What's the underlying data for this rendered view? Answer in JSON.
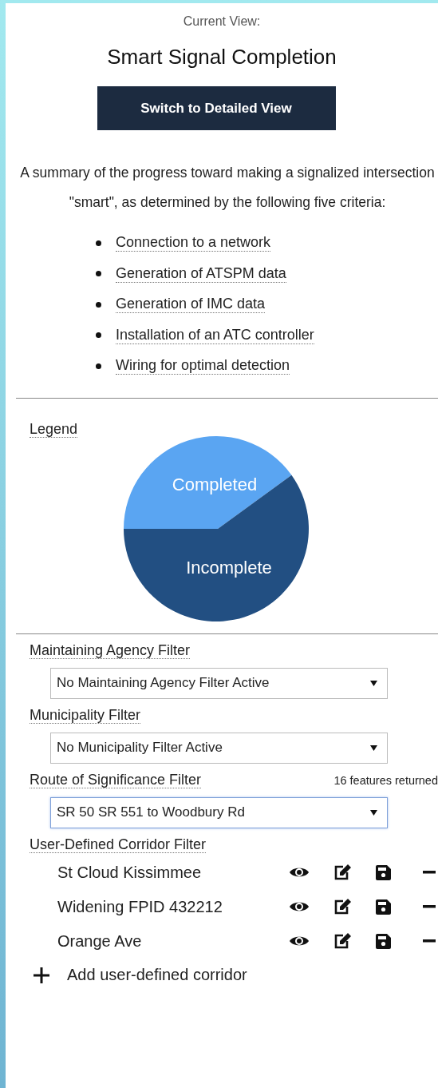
{
  "header": {
    "caption": "Current View:",
    "title": "Smart Signal Completion",
    "button": "Switch to Detailed View"
  },
  "description": "A summary of the progress toward making a signalized intersection \"smart\", as determined by the following five criteria:",
  "criteria": [
    "Connection to a network",
    "Generation of ATSPM data",
    "Generation of IMC data",
    "Installation of an ATC controller",
    "Wiring for optimal detection"
  ],
  "legend": {
    "title": "Legend",
    "items": [
      {
        "label": "Completed",
        "color": "#5aa5f2"
      },
      {
        "label": "Incomplete",
        "color": "#224f82"
      }
    ]
  },
  "filters": [
    {
      "label": "Maintaining Agency Filter",
      "value": "No Maintaining Agency Filter Active",
      "focused": false
    },
    {
      "label": "Municipality Filter",
      "value": "No Municipality Filter Active",
      "focused": false
    },
    {
      "label": "Route of Significance Filter",
      "note": "16 features returned",
      "value": "SR 50 SR 551 to Woodbury Rd",
      "focused": true
    }
  ],
  "corridors": {
    "label": "User-Defined Corridor Filter",
    "items": [
      {
        "name": "St Cloud Kissimmee"
      },
      {
        "name": "Widening FPID 432212"
      },
      {
        "name": "Orange Ave"
      }
    ],
    "add": "Add user-defined corridor"
  }
}
